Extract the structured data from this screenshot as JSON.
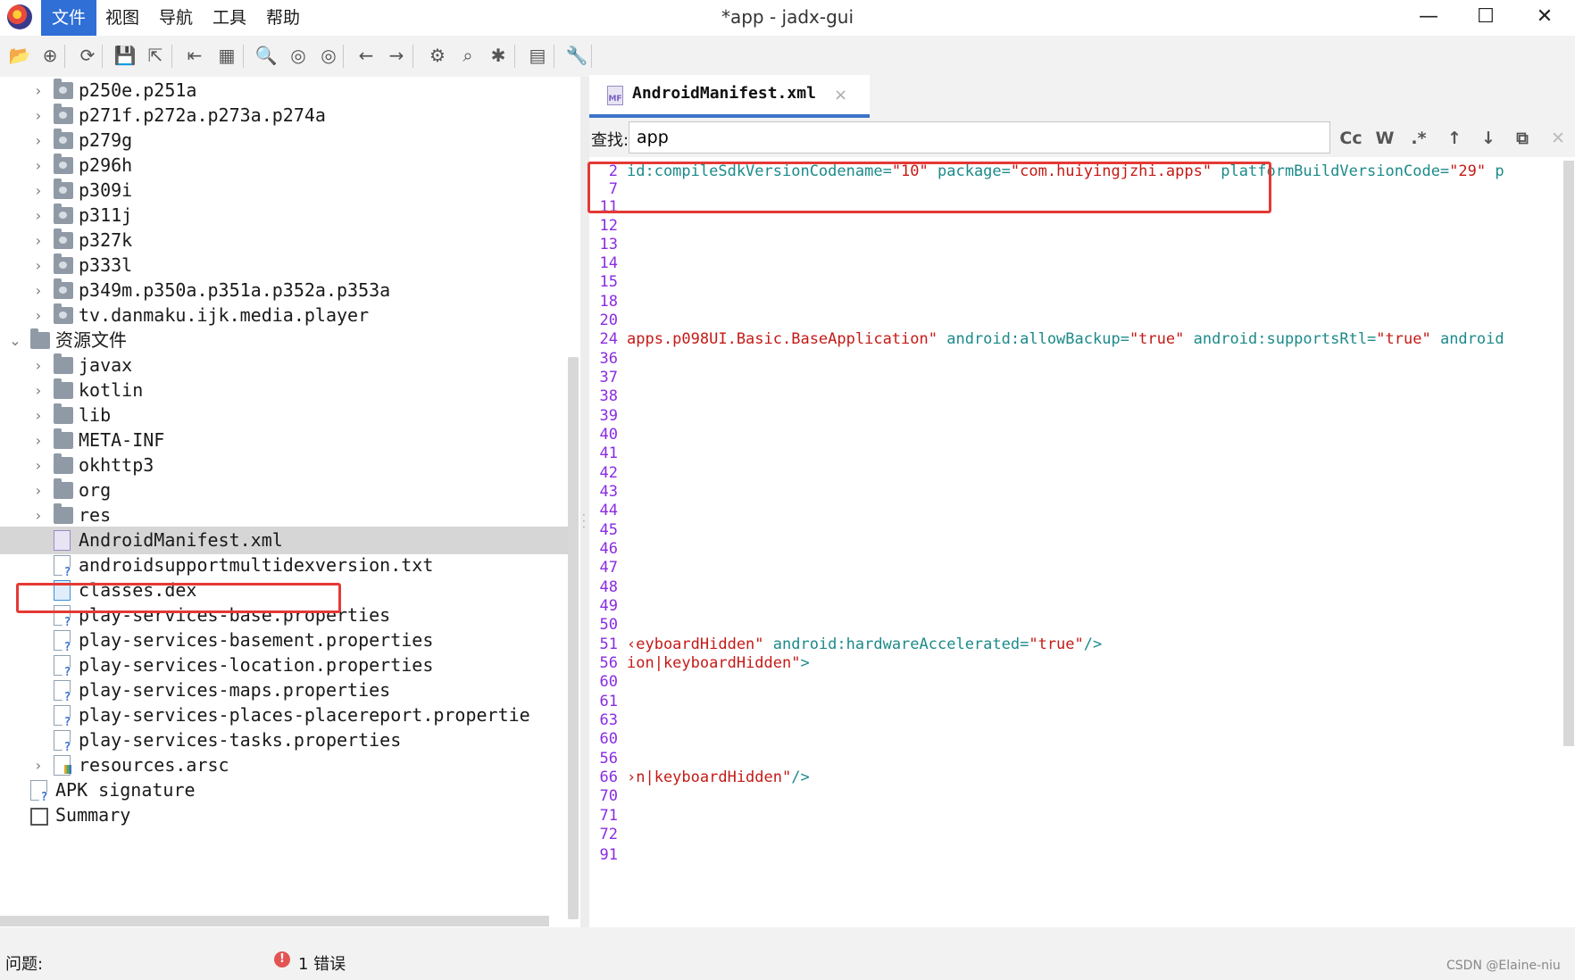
{
  "menu": {
    "file": "文件",
    "view": "视图",
    "navigation": "导航",
    "tools": "工具",
    "help": "帮助"
  },
  "window": {
    "title": "*app - jadx-gui",
    "minimize": "—",
    "maximize": "☐",
    "close": "✕"
  },
  "toolbar_icons": [
    "open-file-icon",
    "add-files-icon",
    "reload-icon",
    "save-all-icon",
    "export-icon",
    "sync-tree-icon",
    "flatten-packages-icon",
    "search-icon",
    "class-search-icon",
    "usage-search-icon",
    "back-icon",
    "forward-icon",
    "deobfuscation-icon",
    "quick-tab-icon",
    "debug-icon",
    "log-icon",
    "preferences-icon"
  ],
  "tree": {
    "rows": [
      {
        "label": "p250e.p251a",
        "type": "package"
      },
      {
        "label": "p271f.p272a.p273a.p274a",
        "type": "package"
      },
      {
        "label": "p279g",
        "type": "package"
      },
      {
        "label": "p296h",
        "type": "package"
      },
      {
        "label": "p309i",
        "type": "package"
      },
      {
        "label": "p311j",
        "type": "package"
      },
      {
        "label": "p327k",
        "type": "package"
      },
      {
        "label": "p333l",
        "type": "package"
      },
      {
        "label": "p349m.p350a.p351a.p352a.p353a",
        "type": "package"
      },
      {
        "label": "tv.danmaku.ijk.media.player",
        "type": "package"
      },
      {
        "label": "资源文件",
        "type": "resources"
      },
      {
        "label": "javax",
        "type": "folder"
      },
      {
        "label": "kotlin",
        "type": "folder"
      },
      {
        "label": "lib",
        "type": "folder"
      },
      {
        "label": "META-INF",
        "type": "folder"
      },
      {
        "label": "okhttp3",
        "type": "folder"
      },
      {
        "label": "org",
        "type": "folder"
      },
      {
        "label": "res",
        "type": "folder"
      },
      {
        "label": "AndroidManifest.xml",
        "type": "manifest"
      },
      {
        "label": "androidsupportmultidexversion.txt",
        "type": "file"
      },
      {
        "label": "classes.dex",
        "type": "dex"
      },
      {
        "label": "play-services-base.properties",
        "type": "file"
      },
      {
        "label": "play-services-basement.properties",
        "type": "file"
      },
      {
        "label": "play-services-location.properties",
        "type": "file"
      },
      {
        "label": "play-services-maps.properties",
        "type": "file"
      },
      {
        "label": "play-services-places-placereport.propertie",
        "type": "file"
      },
      {
        "label": "play-services-tasks.properties",
        "type": "file"
      },
      {
        "label": "resources.arsc",
        "type": "arsc"
      },
      {
        "label": "APK signature",
        "type": "signature"
      },
      {
        "label": "Summary",
        "type": "summary"
      }
    ]
  },
  "editor": {
    "tab_label": "AndroidManifest.xml",
    "tab_icon_text": "MF",
    "tab_close": "×",
    "search_label": "查找:",
    "search_value": "app",
    "search_buttons": [
      "Cc",
      "W",
      ".*",
      "↑",
      "↓",
      "⧉",
      "✕"
    ],
    "lines": [
      {
        "n": "2",
        "segs": [
          [
            "attr",
            "id:compileSdkVersionCodename="
          ],
          [
            "str",
            "\"10\""
          ],
          [
            "attr",
            " package="
          ],
          [
            "str",
            "\"com.huiyingjzhi.apps\""
          ],
          [
            "attr",
            " platformBuildVersionCode="
          ],
          [
            "str",
            "\"29\""
          ],
          [
            "attr",
            " p"
          ]
        ]
      },
      {
        "n": "7",
        "segs": []
      },
      {
        "n": "11",
        "segs": []
      },
      {
        "n": "12",
        "segs": []
      },
      {
        "n": "13",
        "segs": []
      },
      {
        "n": "14",
        "segs": []
      },
      {
        "n": "15",
        "segs": []
      },
      {
        "n": "18",
        "segs": []
      },
      {
        "n": "20",
        "segs": []
      },
      {
        "n": "24",
        "segs": [
          [
            "str",
            "apps.p098UI.Basic.BaseApplication\""
          ],
          [
            "attr",
            " android:allowBackup="
          ],
          [
            "str",
            "\"true\""
          ],
          [
            "attr",
            " android:supportsRtl="
          ],
          [
            "str",
            "\"true\""
          ],
          [
            "attr",
            " android"
          ]
        ]
      },
      {
        "n": "36",
        "segs": []
      },
      {
        "n": "37",
        "segs": []
      },
      {
        "n": "38",
        "segs": []
      },
      {
        "n": "39",
        "segs": []
      },
      {
        "n": "40",
        "segs": []
      },
      {
        "n": "41",
        "segs": []
      },
      {
        "n": "42",
        "segs": []
      },
      {
        "n": "43",
        "segs": []
      },
      {
        "n": "44",
        "segs": []
      },
      {
        "n": "45",
        "segs": []
      },
      {
        "n": "46",
        "segs": []
      },
      {
        "n": "47",
        "segs": []
      },
      {
        "n": "48",
        "segs": []
      },
      {
        "n": "49",
        "segs": []
      },
      {
        "n": "50",
        "segs": []
      },
      {
        "n": "51",
        "segs": [
          [
            "str",
            "‹eyboardHidden\""
          ],
          [
            "attr",
            " android:hardwareAccelerated="
          ],
          [
            "str",
            "\"true\""
          ],
          [
            "tag",
            "/>"
          ]
        ]
      },
      {
        "n": "56",
        "segs": [
          [
            "str",
            "ion|keyboardHidden\""
          ],
          [
            "tag",
            ">"
          ]
        ]
      },
      {
        "n": "60",
        "segs": []
      },
      {
        "n": "61",
        "segs": []
      },
      {
        "n": "63",
        "segs": []
      },
      {
        "n": "60",
        "segs": []
      },
      {
        "n": "56",
        "segs": []
      },
      {
        "n": "66",
        "segs": [
          [
            "str",
            "›n|keyboardHidden\""
          ],
          [
            "tag",
            "/>"
          ]
        ]
      },
      {
        "n": "70",
        "segs": []
      },
      {
        "n": "71",
        "segs": []
      },
      {
        "n": "72",
        "segs": []
      },
      {
        "n": "91",
        "segs": []
      }
    ]
  },
  "status": {
    "issues_label": "问题:",
    "error_icon": "!",
    "error_count": "1 错误",
    "watermark": "CSDN @Elaine-niu"
  },
  "colors": {
    "accent": "#2f6fd6",
    "highlight_box": "#e53935",
    "line_number": "#8a2be2",
    "xml_attr": "#1c8a8a",
    "xml_string": "#c41a16"
  }
}
